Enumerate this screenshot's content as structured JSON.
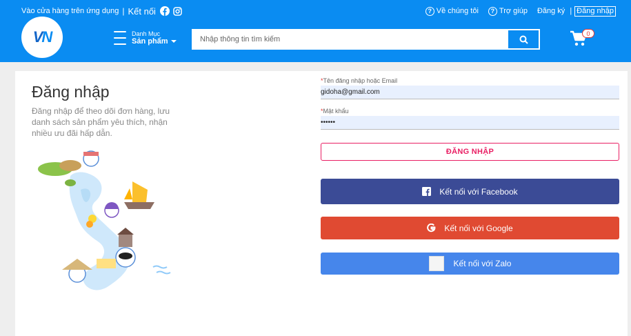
{
  "header": {
    "app_store_text": "Vào cửa hàng trên ứng dụng",
    "separator": "|",
    "connect_text": "Kết nối",
    "about_label": "Về chúng tôi",
    "help_label": "Trợ giúp",
    "register_label": "Đăng ký",
    "pipe": "|",
    "login_label": "Đăng nhập",
    "logo_text_v": "V",
    "logo_text_n": "N",
    "menu_small": "Danh Mục",
    "menu_big": "Sản phẩm",
    "search_placeholder": "Nhập thông tin tìm kiếm",
    "cart_count": "0"
  },
  "main": {
    "title": "Đăng nhập",
    "description": "Đăng nhập để theo dõi đơn hàng, lưu danh sách sản phẩm yêu thích, nhận nhiều ưu đãi hấp dẫn."
  },
  "form": {
    "required_mark": "*",
    "username_label": "Tên đăng nhập hoặc Email",
    "username_value": "gidoha@gmail.com",
    "password_label": "Mật khẩu",
    "password_value": "••••••",
    "login_button": "ĐĂNG NHẬP",
    "facebook_button": "Kết nối với Facebook",
    "google_button": "Kết nối với Google",
    "zalo_button": "Kết nối với Zalo"
  },
  "colors": {
    "brand_blue": "#0a8cf2",
    "facebook": "#3b4b96",
    "google": "#e04a32",
    "zalo": "#4686eb",
    "login_accent": "#e91e63"
  }
}
